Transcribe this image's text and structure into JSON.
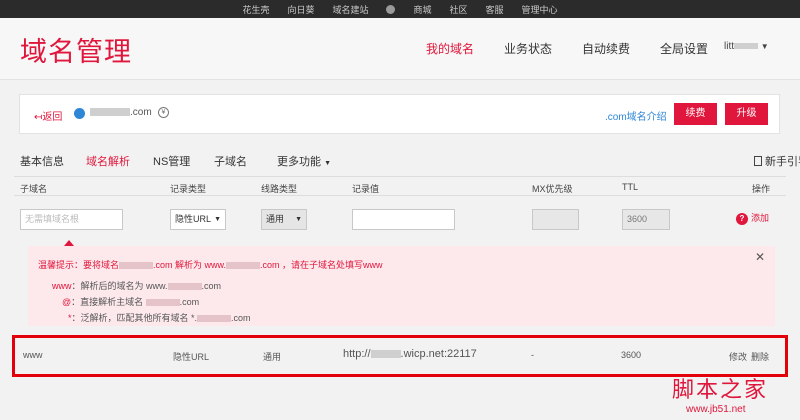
{
  "topbar": {
    "items": [
      "花生壳",
      "向日葵",
      "域名建站",
      "商城",
      "社区",
      "客服",
      "管理中心"
    ]
  },
  "header": {
    "title": "域名管理",
    "nav": [
      {
        "label": "我的域名",
        "active": true
      },
      {
        "label": "业务状态",
        "active": false
      },
      {
        "label": "自动续费",
        "active": false
      },
      {
        "label": "全局设置",
        "active": false
      }
    ],
    "user": "litt"
  },
  "domainbar": {
    "back": "↤返回",
    "domain_suffix": ".com",
    "intro_link": ".com域名介绍",
    "renew_button": "续费",
    "upgrade_button": "升级"
  },
  "tabs": {
    "items": [
      "基本信息",
      "域名解析",
      "NS管理",
      "子域名",
      "更多功能"
    ],
    "active": "域名解析",
    "guide": "新手引导"
  },
  "table": {
    "headers": [
      "子域名",
      "记录类型",
      "线路类型",
      "记录值",
      "MX优先级",
      "TTL",
      "操作"
    ],
    "form": {
      "subdomain_placeholder": "无需填域名根",
      "record_type": "隐性URL",
      "line_type": "通用",
      "ttl": "3600",
      "add_label": "添加"
    }
  },
  "tip": {
    "title_a": "温馨提示：要将域名",
    "title_b": ".com 解析为 www.",
    "title_c": ".com ，请在子域名处填写www",
    "line1_key": "www",
    "line1_a": "：解析后的域名为 www.",
    "line1_b": ".com",
    "line2_key": "@",
    "line2_a": "：直接解析主域名",
    "line2_b": ".com",
    "line3_key": "*",
    "line3_a": "：泛解析，匹配其他所有域名 *.",
    "line3_b": ".com"
  },
  "record": {
    "subdomain": "www",
    "type": "隐性URL",
    "line": "通用",
    "value_prefix": "http://",
    "value_suffix": ".wicp.net:22117",
    "mx": "-",
    "ttl": "3600",
    "edit": "修改",
    "delete": "删除"
  },
  "watermark": {
    "cn": "脚本之家",
    "url": "www.jb51.net"
  },
  "colors": {
    "accent": "#e0163c",
    "highlight_border": "#e3000b",
    "link": "#2e86d6"
  }
}
